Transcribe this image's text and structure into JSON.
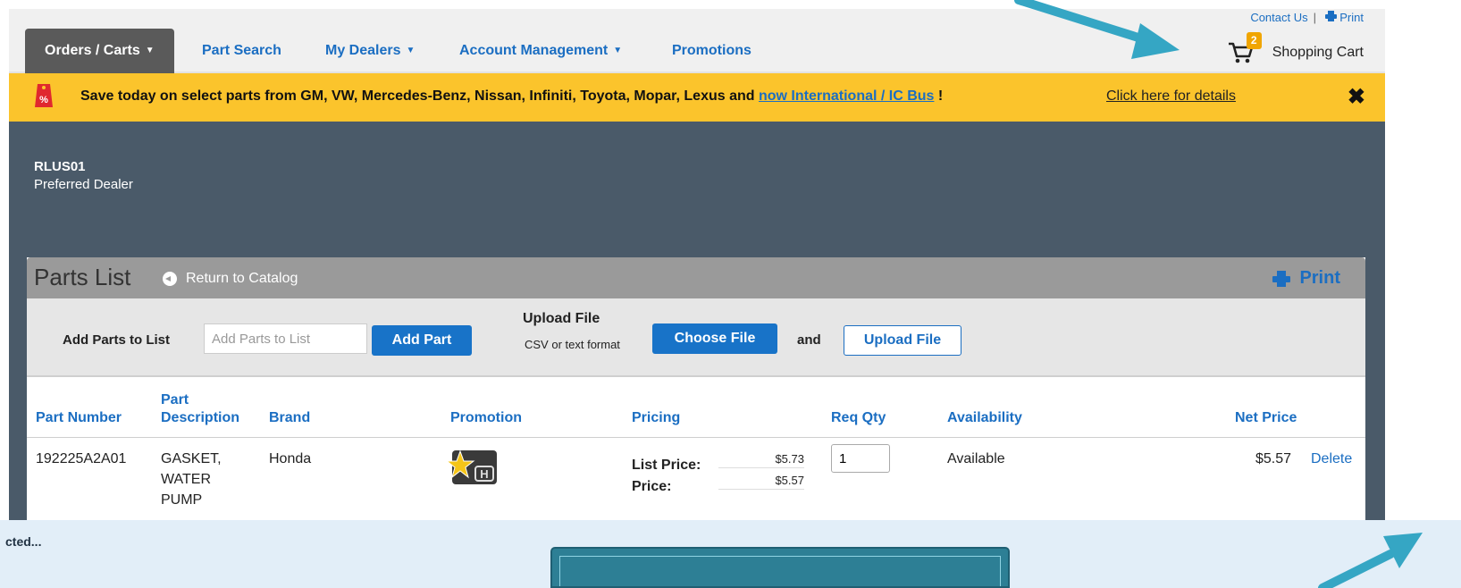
{
  "header": {
    "contact_label": "Contact Us",
    "print_label": "Print",
    "cart": {
      "label": "Shopping Cart",
      "count": "2"
    },
    "tabs": [
      {
        "label": "Orders / Carts",
        "has_menu": true
      },
      {
        "label": "Part Search",
        "has_menu": false
      },
      {
        "label": "My Dealers",
        "has_menu": true
      },
      {
        "label": "Account Management",
        "has_menu": true
      },
      {
        "label": "Promotions",
        "has_menu": false
      }
    ]
  },
  "banner": {
    "text": "Save today on select parts from GM, VW, Mercedes-Benz, Nissan, Infiniti, Toyota, Mopar, Lexus and ",
    "link_text": "now International / IC Bus",
    "after_link": " !",
    "details_link": "Click here for details",
    "close_symbol": "✖"
  },
  "dealer": {
    "code": "RLUS01",
    "type": "Preferred Dealer"
  },
  "parts_list": {
    "title": "Parts List",
    "return_link": "Return to Catalog",
    "print_label": "Print",
    "toolbar": {
      "add_label": "Add Parts to List",
      "add_placeholder": "Add Parts to List",
      "add_button": "Add Part",
      "upload_title": "Upload File",
      "upload_sub": "CSV or text format",
      "choose_button": "Choose File",
      "and_label": "and",
      "upload_button": "Upload File"
    },
    "columns": {
      "part_number": "Part Number",
      "part_desc_1": "Part",
      "part_desc_2": "Description",
      "brand": "Brand",
      "promotion": "Promotion",
      "pricing": "Pricing",
      "req_qty": "Req Qty",
      "availability": "Availability",
      "net_price": "Net Price"
    },
    "rows": [
      {
        "part_number": "192225A2A01",
        "desc_1": "GASKET,",
        "desc_2": "WATER",
        "desc_3": "PUMP",
        "brand": "Honda",
        "list_price_label": "List Price:",
        "list_price": "$5.73",
        "price_label": "Price:",
        "price": "$5.57",
        "qty": "1",
        "availability": "Available",
        "net_price": "$5.57",
        "delete_label": "Delete"
      }
    ]
  },
  "status": {
    "text": "cted..."
  },
  "colors": {
    "accent": "#1b6ec2",
    "banner": "#fbc42c",
    "dark_bg": "#4a5a69",
    "arrow": "#35a6c4"
  }
}
